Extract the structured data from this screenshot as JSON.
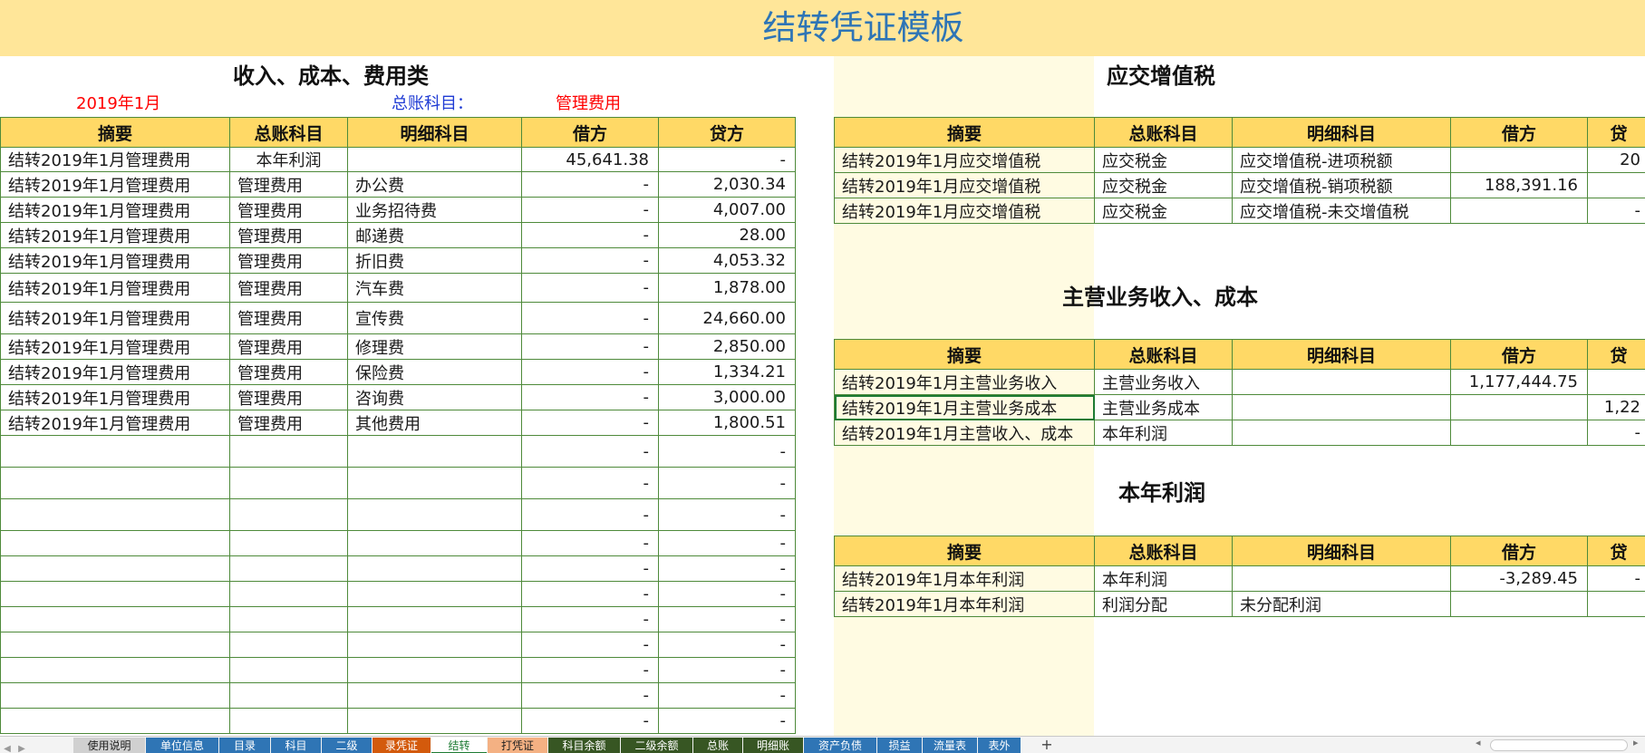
{
  "title": "结转凭证模板",
  "left": {
    "heading": "收入、成本、费用类",
    "period": "2019年1月",
    "account_label": "总账科目：",
    "account_value": "管理费用",
    "headers": [
      "摘要",
      "总账科目",
      "明细科目",
      "借方",
      "贷方"
    ],
    "rows": [
      [
        "结转2019年1月管理费用",
        "本年利润",
        "",
        "45,641.38",
        "-"
      ],
      [
        "结转2019年1月管理费用",
        "管理费用",
        "办公费",
        "-",
        "2,030.34"
      ],
      [
        "结转2019年1月管理费用",
        "管理费用",
        "业务招待费",
        "-",
        "4,007.00"
      ],
      [
        "结转2019年1月管理费用",
        "管理费用",
        "邮递费",
        "-",
        "28.00"
      ],
      [
        "结转2019年1月管理费用",
        "管理费用",
        "折旧费",
        "-",
        "4,053.32"
      ],
      [
        "结转2019年1月管理费用",
        "管理费用",
        "汽车费",
        "-",
        "1,878.00"
      ],
      [
        "结转2019年1月管理费用",
        "管理费用",
        "宣传费",
        "-",
        "24,660.00"
      ],
      [
        "结转2019年1月管理费用",
        "管理费用",
        "修理费",
        "-",
        "2,850.00"
      ],
      [
        "结转2019年1月管理费用",
        "管理费用",
        "保险费",
        "-",
        "1,334.21"
      ],
      [
        "结转2019年1月管理费用",
        "管理费用",
        "咨询费",
        "-",
        "3,000.00"
      ],
      [
        "结转2019年1月管理费用",
        "管理费用",
        "其他费用",
        "-",
        "1,800.51"
      ],
      [
        "",
        "",
        "",
        "-",
        "-"
      ],
      [
        "",
        "",
        "",
        "-",
        "-"
      ],
      [
        "",
        "",
        "",
        "-",
        "-"
      ],
      [
        "",
        "",
        "",
        "-",
        "-"
      ],
      [
        "",
        "",
        "",
        "-",
        "-"
      ],
      [
        "",
        "",
        "",
        "-",
        "-"
      ],
      [
        "",
        "",
        "",
        "-",
        "-"
      ],
      [
        "",
        "",
        "",
        "-",
        "-"
      ],
      [
        "",
        "",
        "",
        "-",
        "-"
      ],
      [
        "",
        "",
        "",
        "-",
        "-"
      ],
      [
        "",
        "",
        "",
        "-",
        "-"
      ]
    ]
  },
  "vat": {
    "heading": "应交增值税",
    "headers": [
      "摘要",
      "总账科目",
      "明细科目",
      "借方",
      "贷"
    ],
    "rows": [
      [
        "结转2019年1月应交增值税",
        "应交税金",
        "应交增值税-进项税额",
        "",
        "20"
      ],
      [
        "结转2019年1月应交增值税",
        "应交税金",
        "应交增值税-销项税额",
        "188,391.16",
        ""
      ],
      [
        "结转2019年1月应交增值税",
        "应交税金",
        "应交增值税-未交增值税",
        "",
        "-"
      ]
    ]
  },
  "revenue": {
    "heading": "主营业务收入、成本",
    "headers": [
      "摘要",
      "总账科目",
      "明细科目",
      "借方",
      "贷"
    ],
    "rows": [
      [
        "结转2019年1月主营业务收入",
        "主营业务收入",
        "",
        "1,177,444.75",
        ""
      ],
      [
        "结转2019年1月主营业务成本",
        "主营业务成本",
        "",
        "",
        "1,22"
      ],
      [
        "结转2019年1月主营收入、成本",
        "本年利润",
        "",
        "",
        "-"
      ]
    ]
  },
  "profit": {
    "heading": "本年利润",
    "headers": [
      "摘要",
      "总账科目",
      "明细科目",
      "借方",
      "贷"
    ],
    "rows": [
      [
        "结转2019年1月本年利润",
        "本年利润",
        "",
        "-3,289.45",
        "-"
      ],
      [
        "结转2019年1月本年利润",
        "利润分配",
        "未分配利润",
        "",
        ""
      ]
    ]
  },
  "tabs": [
    {
      "label": "使用说明",
      "style": "gray"
    },
    {
      "label": "单位信息",
      "style": "blue"
    },
    {
      "label": "目录",
      "style": "blue"
    },
    {
      "label": "科目",
      "style": "blue"
    },
    {
      "label": "二级",
      "style": "blue"
    },
    {
      "label": "录凭证",
      "style": "orange"
    },
    {
      "label": "结转",
      "style": "active"
    },
    {
      "label": "打凭证",
      "style": "peach"
    },
    {
      "label": "科目余额",
      "style": "green"
    },
    {
      "label": "二级余额",
      "style": "green"
    },
    {
      "label": "总账",
      "style": "green"
    },
    {
      "label": "明细账",
      "style": "green"
    },
    {
      "label": "资产负债",
      "style": "blue"
    },
    {
      "label": "损益",
      "style": "blue"
    },
    {
      "label": "流量表",
      "style": "blue"
    },
    {
      "label": "表外",
      "style": "blue"
    }
  ],
  "add_sheet_icon": "plus-icon"
}
